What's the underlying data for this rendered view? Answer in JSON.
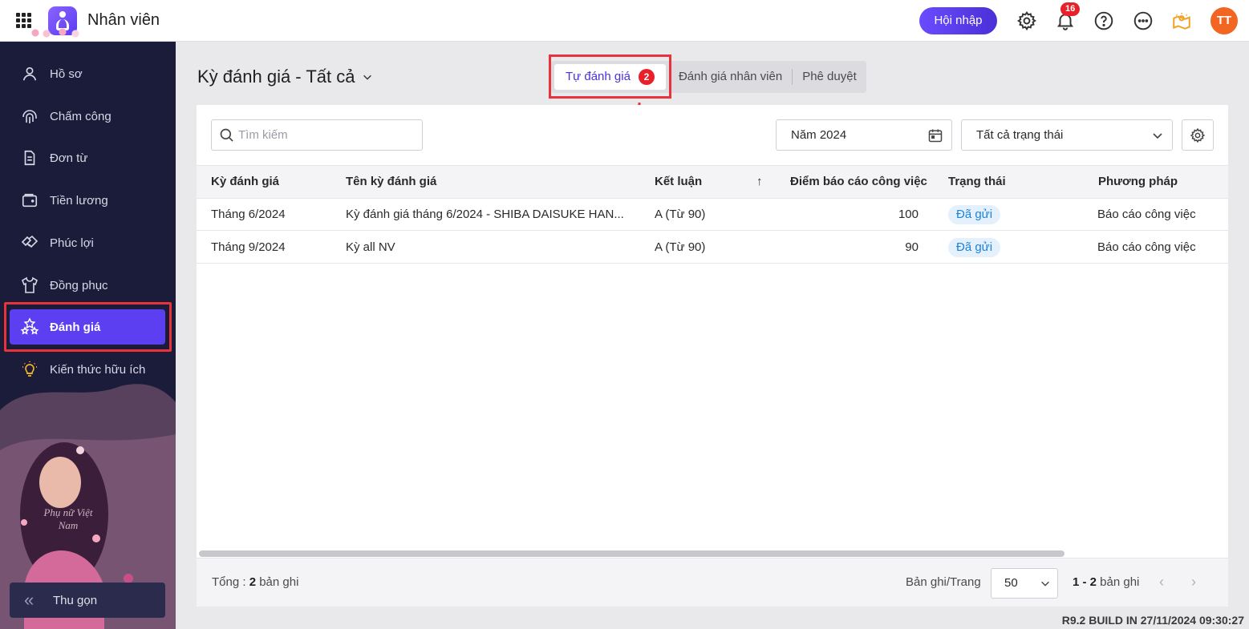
{
  "app": {
    "title": "Nhân viên",
    "integrate_label": "Hội nhập",
    "notification_count": "16",
    "avatar_initials": "TT"
  },
  "sidebar": {
    "items": [
      {
        "label": "Hồ sơ",
        "icon": "person-icon"
      },
      {
        "label": "Chấm công",
        "icon": "fingerprint-icon"
      },
      {
        "label": "Đơn từ",
        "icon": "document-icon"
      },
      {
        "label": "Tiền lương",
        "icon": "wallet-icon"
      },
      {
        "label": "Phúc lợi",
        "icon": "handshake-icon"
      },
      {
        "label": "Đồng phục",
        "icon": "shirt-icon"
      },
      {
        "label": "Đánh giá",
        "icon": "stars-icon",
        "active": true
      },
      {
        "label": "Kiến thức hữu ích",
        "icon": "lightbulb-icon"
      }
    ],
    "decor_text": "Phụ nữ Việt Nam",
    "collapse_label": "Thu gọn"
  },
  "header": {
    "title": "Kỳ đánh giá - Tất cả"
  },
  "tabs": [
    {
      "label": "Tự đánh giá",
      "badge": "2",
      "active": true
    },
    {
      "label": "Đánh giá nhân viên"
    },
    {
      "label": "Phê duyệt"
    }
  ],
  "filters": {
    "search_placeholder": "Tìm kiếm",
    "year": "Năm 2024",
    "status": "Tất cả trạng thái"
  },
  "table": {
    "columns": [
      "Kỳ đánh giá",
      "Tên kỳ đánh giá",
      "Kết luận",
      "Điểm báo cáo công việc",
      "Trạng thái",
      "Phương pháp"
    ],
    "rows": [
      {
        "period": "Tháng 6/2024",
        "name": "Kỳ đánh giá tháng 6/2024 - SHIBA DAISUKE HAN...",
        "conclusion": "A (Từ 90)",
        "score": "100",
        "status": "Đã gửi",
        "method": "Báo cáo công việc"
      },
      {
        "period": "Tháng 9/2024",
        "name": "Kỳ all NV",
        "conclusion": "A (Từ 90)",
        "score": "90",
        "status": "Đã gửi",
        "method": "Báo cáo công việc"
      }
    ]
  },
  "footer": {
    "total_prefix": "Tổng : ",
    "total_count": "2",
    "total_suffix": " bản ghi",
    "per_page_label": "Bản ghi/Trang",
    "per_page_value": "50",
    "range_value": "1 - 2",
    "range_suffix": " bản ghi"
  },
  "build_info": "R9.2 BUILD IN 27/11/2024 09:30:27",
  "colors": {
    "accent": "#5b3ff0",
    "sidebar_bg": "#1b1b3a",
    "highlight": "#e8323c",
    "avatar": "#f26522"
  }
}
